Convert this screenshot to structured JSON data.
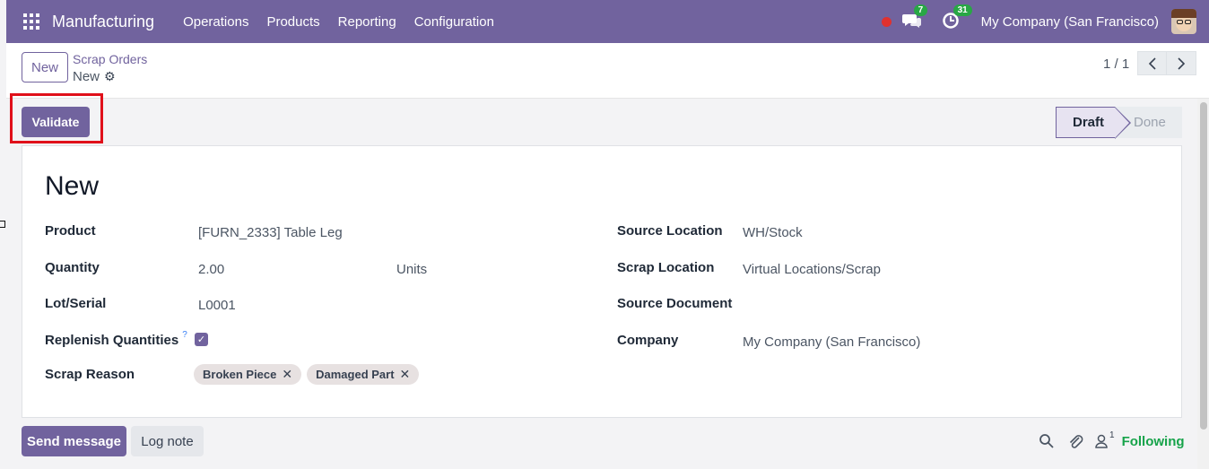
{
  "topbar": {
    "app_name": "Manufacturing",
    "menu": [
      "Operations",
      "Products",
      "Reporting",
      "Configuration"
    ],
    "messages_count": "7",
    "activities_count": "31",
    "company": "My Company (San Francisco)"
  },
  "control": {
    "new_label": "New",
    "breadcrumb_parent": "Scrap Orders",
    "breadcrumb_current": "New",
    "pager": "1 / 1"
  },
  "actions": {
    "validate_label": "Validate"
  },
  "statusbar": {
    "stages": [
      "Draft",
      "Done"
    ],
    "active": "Draft"
  },
  "form": {
    "title": "New",
    "left": {
      "product_label": "Product",
      "product_value": "[FURN_2333] Table Leg",
      "quantity_label": "Quantity",
      "quantity_value": "2.00",
      "uom_value": "Units",
      "lot_label": "Lot/Serial",
      "lot_value": "L0001",
      "replenish_label": "Replenish Quantities",
      "replenish_help": "?",
      "replenish_checked": true,
      "reason_label": "Scrap Reason",
      "reason_tags": [
        "Broken Piece",
        "Damaged Part"
      ]
    },
    "right": {
      "source_location_label": "Source Location",
      "source_location_value": "WH/Stock",
      "scrap_location_label": "Scrap Location",
      "scrap_location_value": "Virtual Locations/Scrap",
      "source_document_label": "Source Document",
      "source_document_value": "",
      "company_label": "Company",
      "company_value": "My Company (San Francisco)"
    }
  },
  "chatter": {
    "send_message_label": "Send message",
    "log_note_label": "Log note",
    "followers_count": "1",
    "following_label": "Following"
  },
  "colors": {
    "brand": "#71639e",
    "following": "#16a34a",
    "badge": "#28a745",
    "highlight": "#e0101a"
  }
}
